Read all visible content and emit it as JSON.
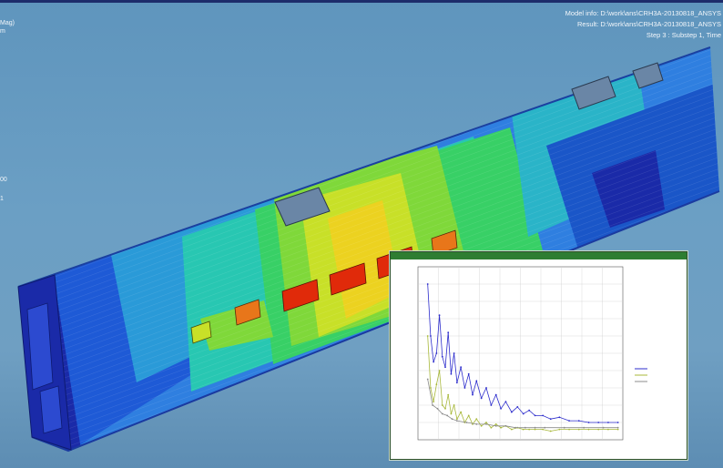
{
  "viewer": {
    "model_info": "Model info: D:\\work\\ans\\CRH3A-20130818_ANSYS",
    "result_info": "Result: D:\\work\\ans\\CRH3A-20130818_ANSYS",
    "step_info": "Step 3 : Substep 1, Time",
    "legend_left": [
      "Mag)",
      "m",
      "00",
      "1"
    ]
  },
  "plot_window": {
    "title": ""
  },
  "colors": {
    "accent": "#2e7d32",
    "background": "#6b9fc4",
    "model_low": "#1a2aa8",
    "model_mid": "#34c864",
    "model_high": "#e02a0a"
  },
  "chart_data": {
    "type": "line",
    "title": "",
    "xlabel": "",
    "ylabel": "",
    "grid": true,
    "legend": "right",
    "xlim": [
      -10,
      200
    ],
    "ylim": [
      0,
      1
    ],
    "series": [
      {
        "color": "#2c2ccc",
        "x": [
          0,
          3,
          6,
          9,
          12,
          15,
          18,
          21,
          24,
          27,
          30,
          34,
          38,
          42,
          46,
          50,
          55,
          60,
          65,
          70,
          75,
          80,
          86,
          92,
          98,
          104,
          110,
          118,
          126,
          135,
          145,
          155,
          165,
          175,
          185,
          195
        ],
        "values": [
          0.9,
          0.6,
          0.45,
          0.5,
          0.72,
          0.48,
          0.42,
          0.62,
          0.38,
          0.5,
          0.33,
          0.42,
          0.3,
          0.38,
          0.26,
          0.34,
          0.24,
          0.3,
          0.2,
          0.26,
          0.18,
          0.22,
          0.16,
          0.19,
          0.15,
          0.17,
          0.14,
          0.14,
          0.12,
          0.13,
          0.11,
          0.11,
          0.1,
          0.1,
          0.1,
          0.1
        ]
      },
      {
        "color": "#a8b83a",
        "x": [
          0,
          3,
          6,
          9,
          12,
          15,
          18,
          21,
          24,
          27,
          30,
          34,
          38,
          42,
          46,
          50,
          55,
          60,
          65,
          70,
          75,
          80,
          86,
          92,
          98,
          104,
          110,
          118,
          126,
          135,
          145,
          155,
          165,
          175,
          185,
          195
        ],
        "values": [
          0.6,
          0.3,
          0.22,
          0.32,
          0.4,
          0.2,
          0.18,
          0.26,
          0.15,
          0.2,
          0.12,
          0.16,
          0.1,
          0.14,
          0.09,
          0.12,
          0.08,
          0.1,
          0.07,
          0.09,
          0.07,
          0.08,
          0.06,
          0.07,
          0.06,
          0.06,
          0.06,
          0.06,
          0.05,
          0.06,
          0.06,
          0.06,
          0.06,
          0.06,
          0.06,
          0.06
        ]
      },
      {
        "color": "#8c8c8c",
        "x": [
          0,
          5,
          10,
          15,
          20,
          25,
          30,
          40,
          50,
          60,
          70,
          80,
          90,
          100,
          110,
          120,
          140,
          160,
          180,
          195
        ],
        "values": [
          0.35,
          0.2,
          0.18,
          0.15,
          0.14,
          0.12,
          0.11,
          0.1,
          0.09,
          0.09,
          0.08,
          0.08,
          0.07,
          0.07,
          0.07,
          0.07,
          0.07,
          0.07,
          0.07,
          0.07
        ]
      }
    ]
  }
}
